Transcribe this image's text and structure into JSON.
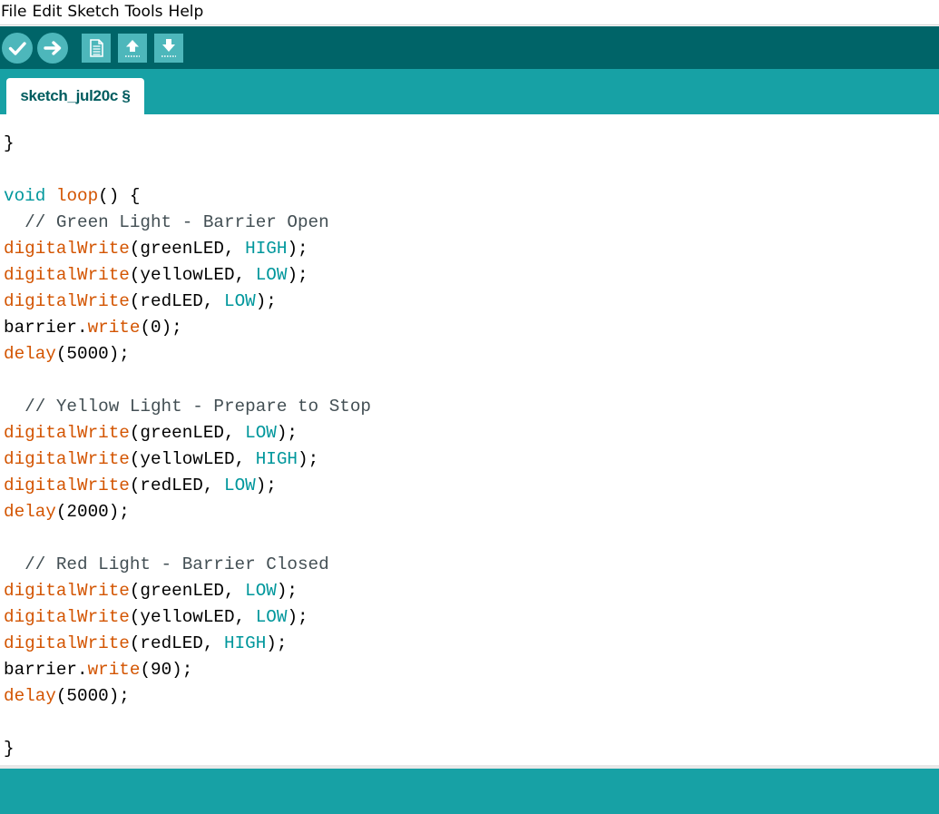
{
  "menubar": {
    "items": [
      "File",
      "Edit",
      "Sketch",
      "Tools",
      "Help"
    ]
  },
  "toolbar": {
    "buttons": [
      {
        "name": "verify-button",
        "icon": "checkmark-icon"
      },
      {
        "name": "upload-button",
        "icon": "arrow-right-icon"
      },
      {
        "name": "new-button",
        "icon": "document-icon"
      },
      {
        "name": "open-button",
        "icon": "arrow-up-icon"
      },
      {
        "name": "save-button",
        "icon": "arrow-down-icon"
      }
    ],
    "colors": {
      "background": "#006468",
      "button": "#4db7bb",
      "icon": "#ffffff"
    }
  },
  "tabs": [
    {
      "label": "sketch_jul20c §"
    }
  ],
  "colors": {
    "tabbar": "#17a1a5",
    "keyword": "#00979c",
    "function": "#d35400",
    "comment": "#434f54"
  },
  "code": {
    "lines": [
      [
        {
          "t": "}",
          "c": "plain"
        }
      ],
      [],
      [
        {
          "t": "void",
          "c": "kw"
        },
        {
          "t": " ",
          "c": "plain"
        },
        {
          "t": "loop",
          "c": "fn"
        },
        {
          "t": "() {",
          "c": "plain"
        }
      ],
      [
        {
          "t": "  // Green Light - Barrier Open",
          "c": "cmt"
        }
      ],
      [
        {
          "t": "digitalWrite",
          "c": "fn"
        },
        {
          "t": "(greenLED, ",
          "c": "plain"
        },
        {
          "t": "HIGH",
          "c": "const"
        },
        {
          "t": ");",
          "c": "plain"
        }
      ],
      [
        {
          "t": "digitalWrite",
          "c": "fn"
        },
        {
          "t": "(yellowLED, ",
          "c": "plain"
        },
        {
          "t": "LOW",
          "c": "const"
        },
        {
          "t": ");",
          "c": "plain"
        }
      ],
      [
        {
          "t": "digitalWrite",
          "c": "fn"
        },
        {
          "t": "(redLED, ",
          "c": "plain"
        },
        {
          "t": "LOW",
          "c": "const"
        },
        {
          "t": ");",
          "c": "plain"
        }
      ],
      [
        {
          "t": "barrier.",
          "c": "plain"
        },
        {
          "t": "write",
          "c": "fn"
        },
        {
          "t": "(0);",
          "c": "plain"
        }
      ],
      [
        {
          "t": "delay",
          "c": "fn"
        },
        {
          "t": "(5000);",
          "c": "plain"
        }
      ],
      [],
      [
        {
          "t": "  // Yellow Light - Prepare to Stop",
          "c": "cmt"
        }
      ],
      [
        {
          "t": "digitalWrite",
          "c": "fn"
        },
        {
          "t": "(greenLED, ",
          "c": "plain"
        },
        {
          "t": "LOW",
          "c": "const"
        },
        {
          "t": ");",
          "c": "plain"
        }
      ],
      [
        {
          "t": "digitalWrite",
          "c": "fn"
        },
        {
          "t": "(yellowLED, ",
          "c": "plain"
        },
        {
          "t": "HIGH",
          "c": "const"
        },
        {
          "t": ");",
          "c": "plain"
        }
      ],
      [
        {
          "t": "digitalWrite",
          "c": "fn"
        },
        {
          "t": "(redLED, ",
          "c": "plain"
        },
        {
          "t": "LOW",
          "c": "const"
        },
        {
          "t": ");",
          "c": "plain"
        }
      ],
      [
        {
          "t": "delay",
          "c": "fn"
        },
        {
          "t": "(2000);",
          "c": "plain"
        }
      ],
      [],
      [
        {
          "t": "  // Red Light - Barrier Closed",
          "c": "cmt"
        }
      ],
      [
        {
          "t": "digitalWrite",
          "c": "fn"
        },
        {
          "t": "(greenLED, ",
          "c": "plain"
        },
        {
          "t": "LOW",
          "c": "const"
        },
        {
          "t": ");",
          "c": "plain"
        }
      ],
      [
        {
          "t": "digitalWrite",
          "c": "fn"
        },
        {
          "t": "(yellowLED, ",
          "c": "plain"
        },
        {
          "t": "LOW",
          "c": "const"
        },
        {
          "t": ");",
          "c": "plain"
        }
      ],
      [
        {
          "t": "digitalWrite",
          "c": "fn"
        },
        {
          "t": "(redLED, ",
          "c": "plain"
        },
        {
          "t": "HIGH",
          "c": "const"
        },
        {
          "t": ");",
          "c": "plain"
        }
      ],
      [
        {
          "t": "barrier.",
          "c": "plain"
        },
        {
          "t": "write",
          "c": "fn"
        },
        {
          "t": "(90);",
          "c": "plain"
        }
      ],
      [
        {
          "t": "delay",
          "c": "fn"
        },
        {
          "t": "(5000);",
          "c": "plain"
        }
      ],
      [],
      [
        {
          "t": "}",
          "c": "plain"
        }
      ]
    ]
  }
}
